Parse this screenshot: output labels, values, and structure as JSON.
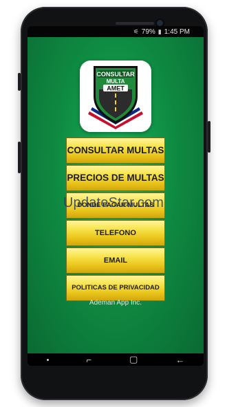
{
  "status": {
    "signal": "⚟",
    "battery": "79%",
    "time": "1:45 PM"
  },
  "logo": {
    "line1": "CONSULTAR",
    "line2": "MULTA",
    "line3": "AMET"
  },
  "menu": {
    "consultar": "CONSULTAR MULTAS",
    "precios": "PRECIOS DE MULTAS",
    "donde": "DONDE PAGAR MULTAS",
    "telefono": "TELEFONO",
    "email": "EMAIL",
    "politicas": "POLITICAS DE PRIVACIDAD"
  },
  "footer": "Ademan App Inc.",
  "watermark": "UpdateStar.com",
  "nav": {
    "recent": "⌐",
    "home": "▢",
    "back": "←"
  }
}
